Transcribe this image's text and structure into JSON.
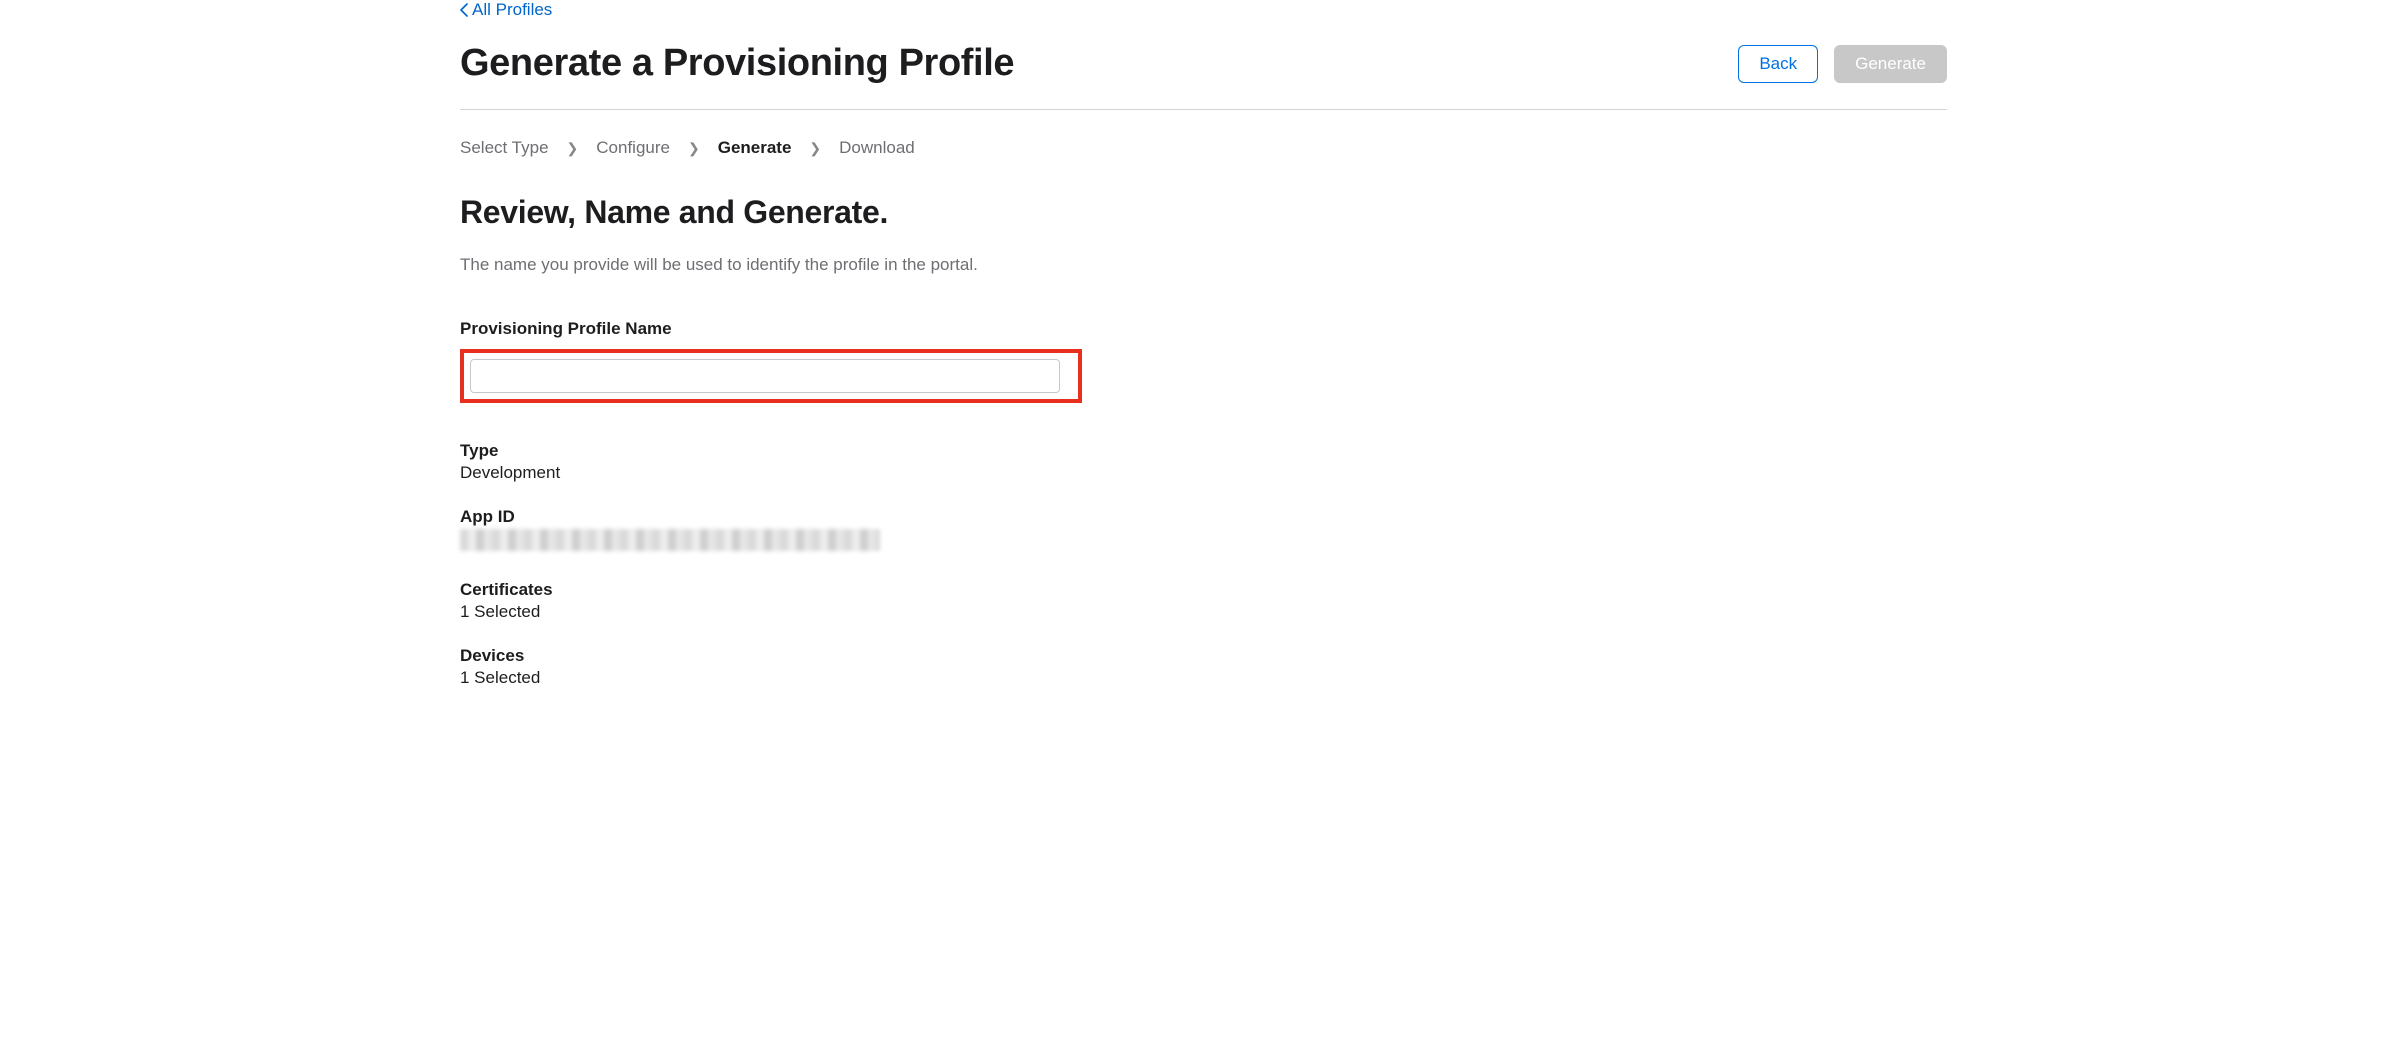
{
  "breadcrumb_link": {
    "label": "All Profiles"
  },
  "header": {
    "title": "Generate a Provisioning Profile",
    "buttons": {
      "back": "Back",
      "generate": "Generate"
    }
  },
  "steps": {
    "s1": "Select Type",
    "s2": "Configure",
    "s3": "Generate",
    "s4": "Download"
  },
  "section": {
    "title": "Review, Name and Generate.",
    "description": "The name you provide will be used to identify the profile in the portal."
  },
  "fields": {
    "profile_name_label": "Provisioning Profile Name",
    "profile_name_value": ""
  },
  "info": {
    "type_label": "Type",
    "type_value": "Development",
    "app_id_label": "App ID",
    "certificates_label": "Certificates",
    "certificates_value": "1 Selected",
    "devices_label": "Devices",
    "devices_value": "1 Selected"
  }
}
